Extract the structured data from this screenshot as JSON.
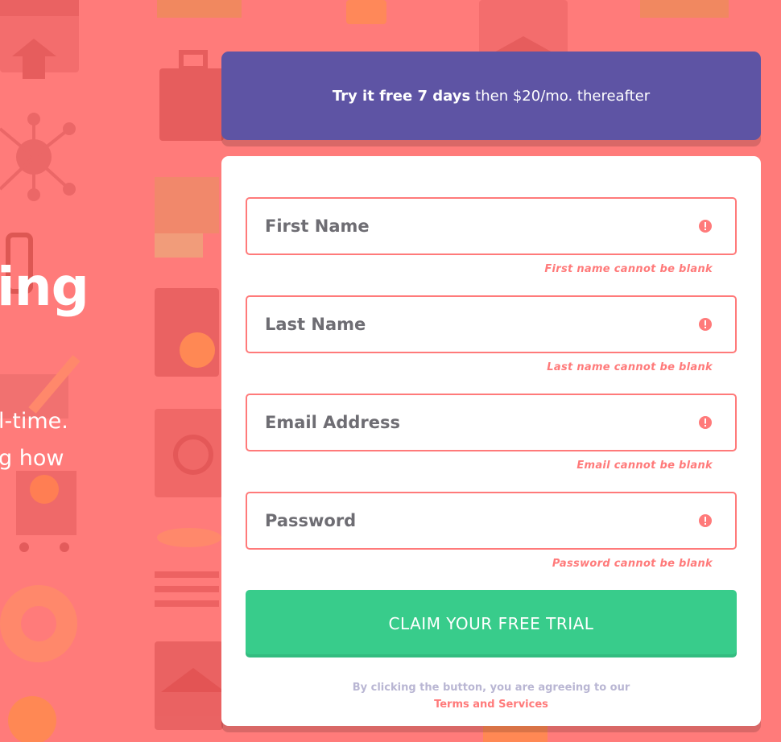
{
  "hero": {
    "title_fragment": "ing",
    "line1_fragment": "l-time.",
    "line2_fragment": "g how"
  },
  "promo": {
    "bold": "Try it free 7 days",
    "rest": "then $20/mo. thereafter"
  },
  "form": {
    "fields": [
      {
        "placeholder": "First Name",
        "error": "First name cannot be blank"
      },
      {
        "placeholder": "Last Name",
        "error": "Last name cannot be blank"
      },
      {
        "placeholder": "Email Address",
        "error": "Email cannot be blank"
      },
      {
        "placeholder": "Password",
        "error": "Password cannot be blank"
      }
    ],
    "submit_label": "CLAIM YOUR FREE TRIAL",
    "terms_text": "By clicking the button, you are agreeing to our",
    "terms_link": "Terms and Services"
  },
  "colors": {
    "background": "#ff7b7a",
    "promo": "#5e54a4",
    "accent_green": "#38cc8b",
    "error_red": "#ff7a7a"
  },
  "icons": {
    "field_error": "error-exclamation-icon"
  }
}
